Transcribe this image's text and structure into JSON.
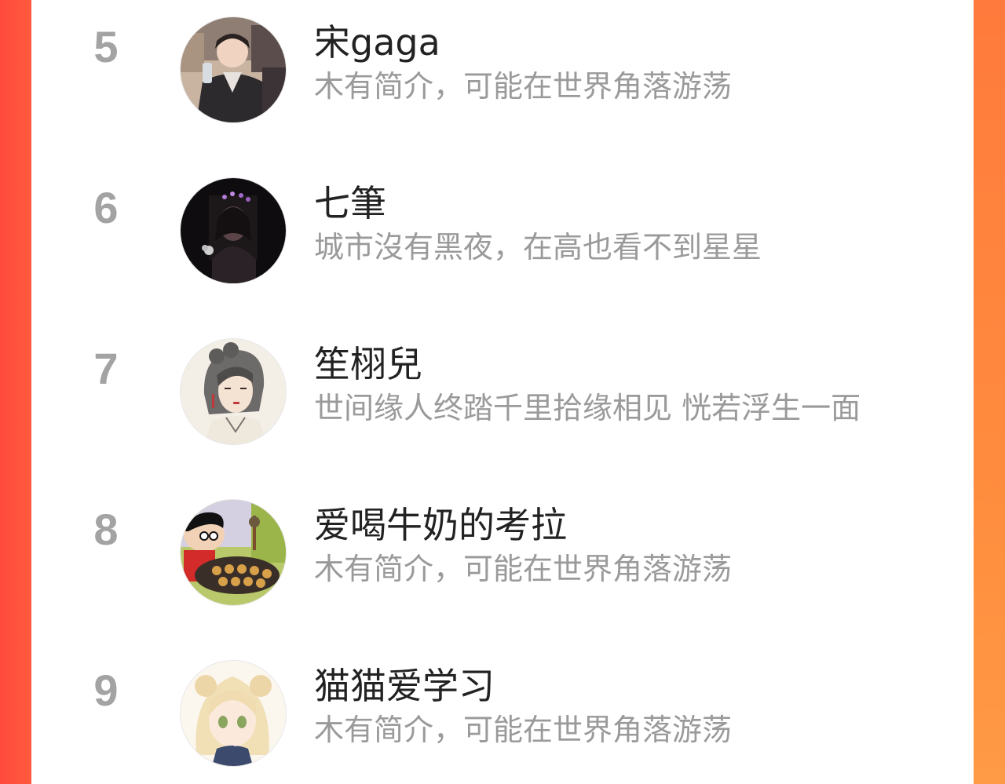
{
  "list": [
    {
      "rank": "5",
      "name": "宋gaga",
      "bio": "木有简介，可能在世界角落游荡",
      "avatar": "photo-avatar-young-man"
    },
    {
      "rank": "6",
      "name": "七筆",
      "bio": "城市沒有黑夜，在高也看不到星星",
      "avatar": "photo-avatar-dark-portrait"
    },
    {
      "rank": "7",
      "name": "笙栩兒",
      "bio": "世间缘人终踏千里拾缘相见 恍若浮生一面",
      "avatar": "illustration-avatar-ancient-woman"
    },
    {
      "rank": "8",
      "name": "爱喝牛奶的考拉",
      "bio": "木有简介，可能在世界角落游荡",
      "avatar": "cartoon-avatar-crayon-boy"
    },
    {
      "rank": "9",
      "name": "猫猫爱学习",
      "bio": "木有简介，可能在世界角落游荡",
      "avatar": "anime-avatar-cat-girl"
    }
  ],
  "colors": {
    "background_left": "#ff4a3d",
    "background_right": "#ff8e42",
    "panel": "#ffffff",
    "rank_text": "#a3a3a3",
    "name_text": "#222222",
    "bio_text": "#9a9a9a"
  }
}
